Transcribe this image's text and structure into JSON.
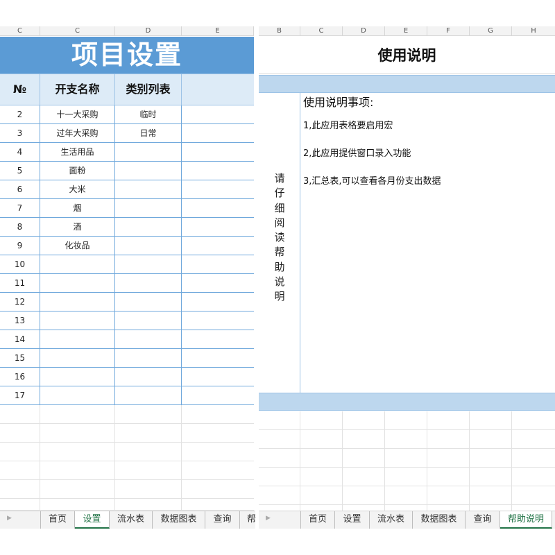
{
  "left": {
    "column_headers": [
      "C",
      "C",
      "D",
      "E"
    ],
    "title": "项目设置",
    "table_headers": [
      "№",
      "开支名称",
      "类别列表"
    ],
    "rows": [
      {
        "no": "2",
        "name": "十一大采购",
        "category": "临时"
      },
      {
        "no": "3",
        "name": "过年大采购",
        "category": "日常"
      },
      {
        "no": "4",
        "name": "生活用品",
        "category": ""
      },
      {
        "no": "5",
        "name": "面粉",
        "category": ""
      },
      {
        "no": "6",
        "name": "大米",
        "category": ""
      },
      {
        "no": "7",
        "name": "烟",
        "category": ""
      },
      {
        "no": "8",
        "name": "酒",
        "category": ""
      },
      {
        "no": "9",
        "name": "化妆品",
        "category": ""
      },
      {
        "no": "10",
        "name": "",
        "category": ""
      },
      {
        "no": "11",
        "name": "",
        "category": ""
      },
      {
        "no": "12",
        "name": "",
        "category": ""
      },
      {
        "no": "13",
        "name": "",
        "category": ""
      },
      {
        "no": "14",
        "name": "",
        "category": ""
      },
      {
        "no": "15",
        "name": "",
        "category": ""
      },
      {
        "no": "16",
        "name": "",
        "category": ""
      },
      {
        "no": "17",
        "name": "",
        "category": ""
      }
    ],
    "tabs": [
      "首页",
      "设置",
      "流水表",
      "数据图表",
      "查询",
      "帮"
    ],
    "active_tab": "设置"
  },
  "right": {
    "column_headers": [
      "B",
      "C",
      "D",
      "E",
      "F",
      "G",
      "H"
    ],
    "title": "使用说明",
    "side_label": "请仔细阅读帮助说明",
    "heading": "使用说明事项:",
    "items": [
      "1,此应用表格要启用宏",
      "2,此应用提供窗口录入功能",
      "3,汇总表,可以查看各月份支出数据"
    ],
    "tabs": [
      "首页",
      "设置",
      "流水表",
      "数据图表",
      "查询",
      "帮助说明"
    ],
    "active_tab": "帮助说明"
  },
  "colors": {
    "title_band": "#5b9bd5",
    "header_band": "#ddebf7",
    "right_band": "#bdd7ee",
    "grid_line": "#6fa8dc",
    "active_tab_text": "#217346"
  }
}
